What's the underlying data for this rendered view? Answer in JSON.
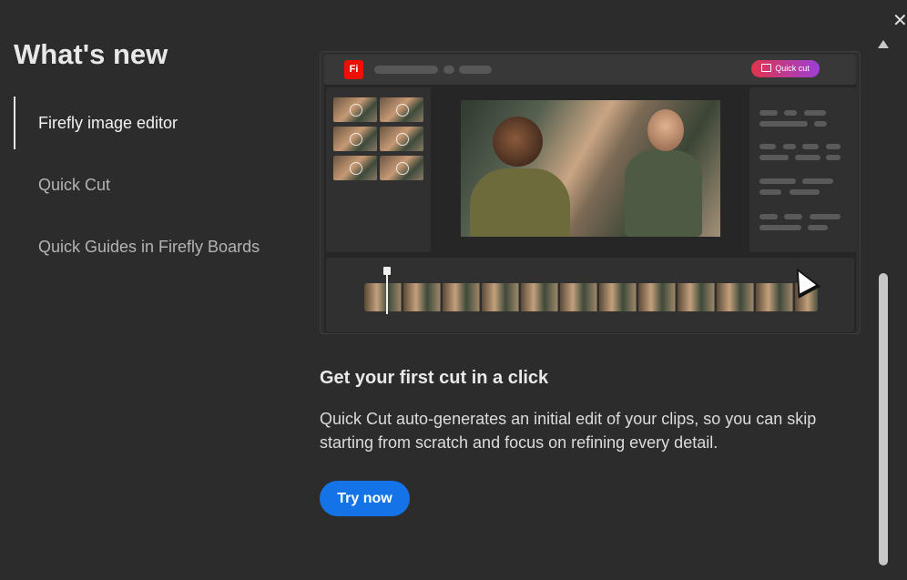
{
  "dialog": {
    "close_icon": "close-icon",
    "title": "What's new"
  },
  "nav": {
    "items": [
      {
        "label": "Firefly image editor",
        "active": true
      },
      {
        "label": "Quick Cut",
        "active": false
      },
      {
        "label": "Quick Guides in Firefly Boards",
        "active": false
      }
    ]
  },
  "hero": {
    "app_logo": "Fi",
    "badge_label": "Quick cut",
    "colors": {
      "logo": "#eb1000",
      "badge_start": "#e0344d",
      "badge_end": "#9c3fd6"
    }
  },
  "content": {
    "headline": "Get your first cut in a click",
    "description": "Quick Cut auto-generates an initial edit of your clips, so you can skip starting from scratch and focus on refining every detail.",
    "cta_label": "Try now",
    "cta_color": "#1473e6"
  }
}
